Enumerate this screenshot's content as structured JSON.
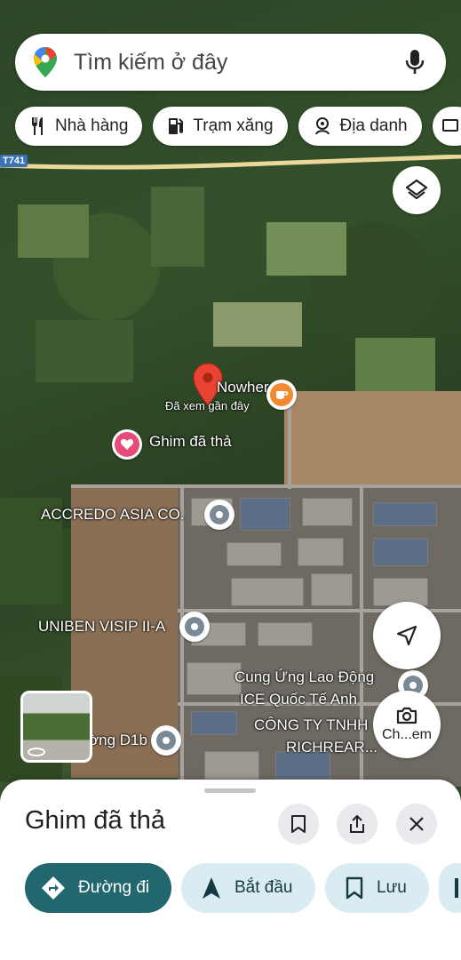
{
  "search": {
    "placeholder": "Tìm kiếm ở đây"
  },
  "chips": [
    {
      "label": "Nhà hàng",
      "icon": "fork-knife-icon"
    },
    {
      "label": "Trạm xăng",
      "icon": "gas-station-icon"
    },
    {
      "label": "Địa danh",
      "icon": "landmark-icon"
    }
  ],
  "map": {
    "road_shield": "T741",
    "pin_label": "Nowhere",
    "pin_sublabel": "Đã xem gần đây",
    "dropped_pin_label": "Ghim đã thả",
    "places": [
      {
        "label": "ACCREDO ASIA CO."
      },
      {
        "label": "UNIBEN VISIP II-A"
      },
      {
        "label": "Cung Ứng Lao Động"
      },
      {
        "label": "ICE Quốc Tế Anh"
      },
      {
        "label": "CÔNG TY TNHH"
      },
      {
        "label": "RICHREAR..."
      },
      {
        "label": "ờng D1b"
      }
    ],
    "street_view_label": "Ch...em"
  },
  "sheet": {
    "title": "Ghim đã thả",
    "actions": [
      {
        "label": "Đường đi"
      },
      {
        "label": "Bắt đầu"
      },
      {
        "label": "Lưu"
      }
    ]
  },
  "colors": {
    "accent": "#22666e",
    "pin": "#ea4335",
    "secondary_button": "#d9ecf2"
  }
}
